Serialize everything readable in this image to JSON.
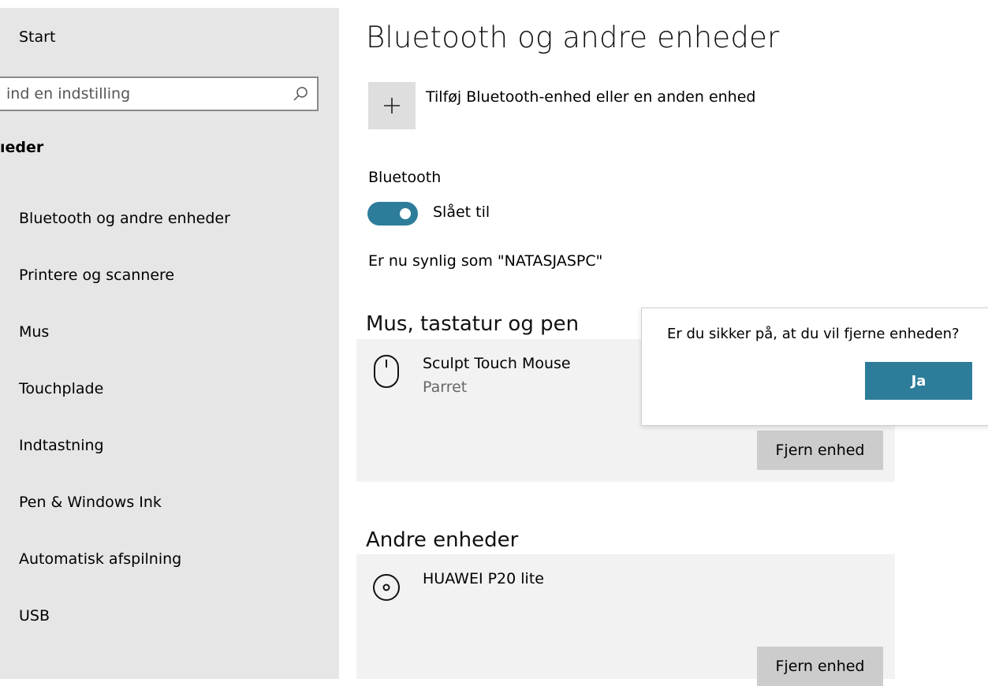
{
  "sidebar": {
    "home_label": "Start",
    "search": {
      "placeholder": "ind en indstilling",
      "value": ""
    },
    "section_heading": "ıeder",
    "items": [
      {
        "label": "Bluetooth og andre enheder"
      },
      {
        "label": "Printere og scannere"
      },
      {
        "label": "Mus"
      },
      {
        "label": "Touchplade"
      },
      {
        "label": "Indtastning"
      },
      {
        "label": "Pen & Windows Ink"
      },
      {
        "label": "Automatisk afspilning"
      },
      {
        "label": "USB"
      }
    ]
  },
  "main": {
    "title": "Bluetooth og andre enheder",
    "add_device_label": "Tilføj Bluetooth-enhed eller en anden enhed",
    "bluetooth": {
      "label": "Bluetooth",
      "state_label": "Slået til",
      "on": true
    },
    "visible_as": "Er nu synlig som \"NATASJASPC\"",
    "sections": [
      {
        "title": "Mus, tastatur og pen",
        "device": {
          "name": "Sculpt Touch Mouse",
          "status": "Parret",
          "icon": "mouse-icon",
          "remove_label": "Fjern enhed"
        }
      },
      {
        "title": "Andre enheder",
        "device": {
          "name": "HUAWEI P20 lite",
          "status": "",
          "icon": "disc-device-icon",
          "remove_label": "Fjern enhed"
        }
      }
    ]
  },
  "confirm": {
    "question": "Er du sikker på, at du vil fjerne enheden?",
    "yes_label": "Ja"
  },
  "colors": {
    "accent": "#2d7d9a",
    "sidebar_bg": "#e6e6e6",
    "card_bg": "#f2f2f2",
    "button_bg": "#cccccc"
  }
}
